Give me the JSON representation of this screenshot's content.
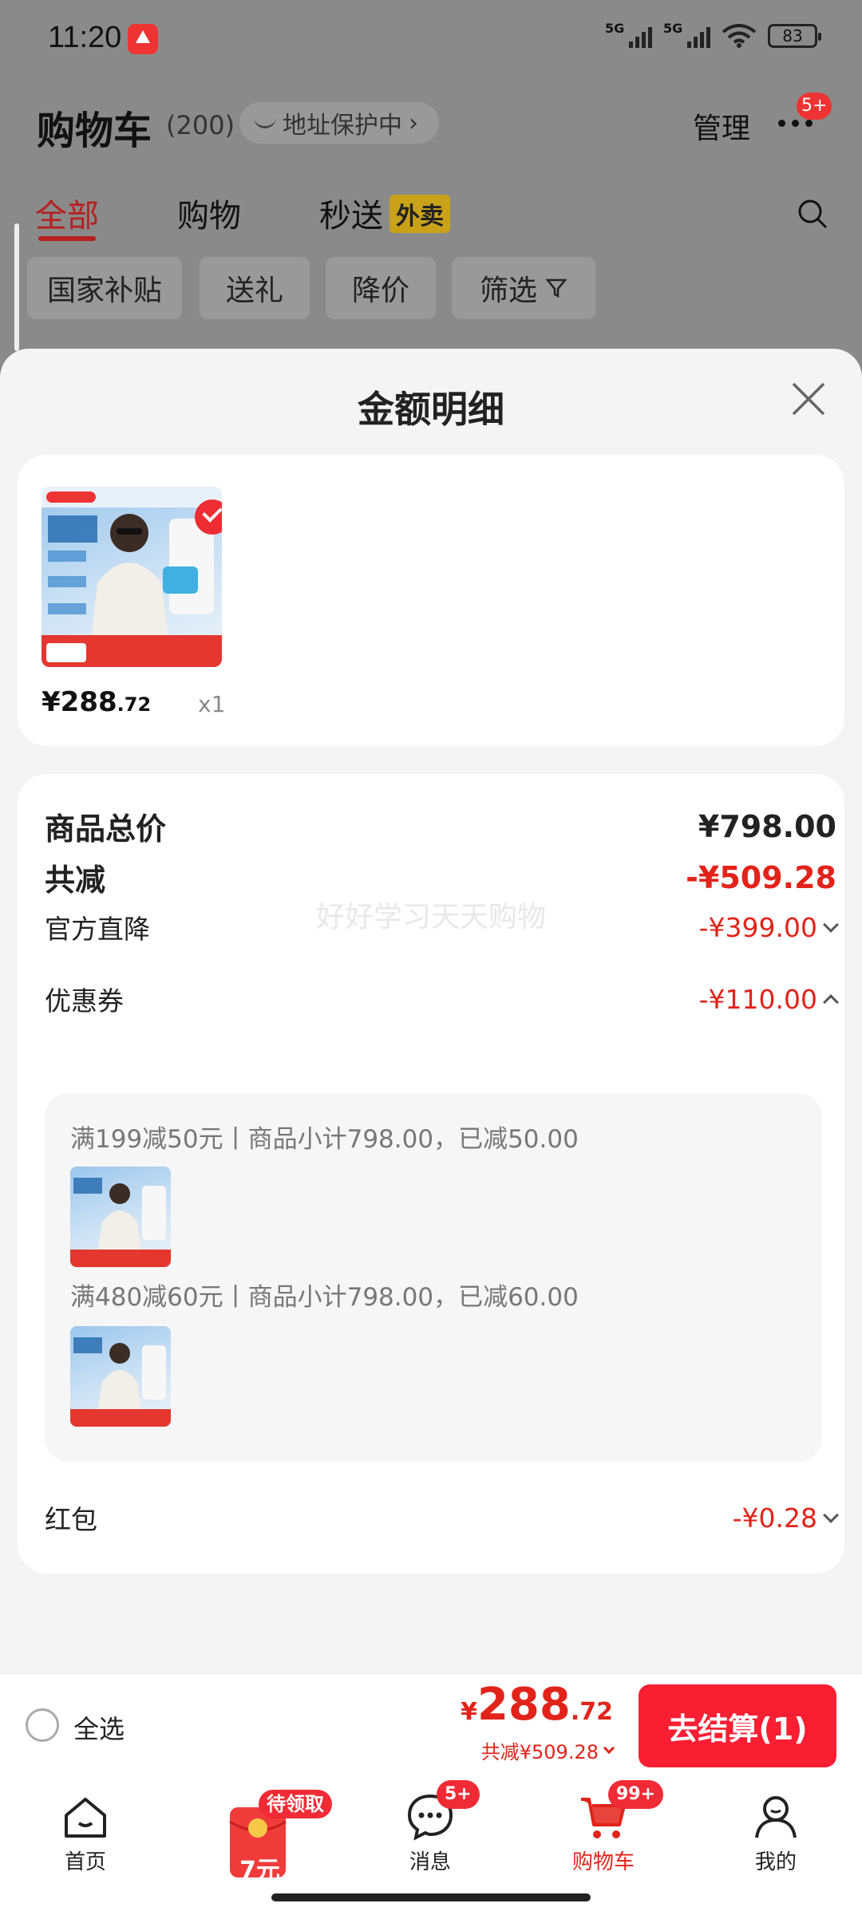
{
  "status": {
    "time": "11:20",
    "signal1": "5G",
    "signal2": "5G",
    "battery": "83"
  },
  "header": {
    "title": "购物车",
    "count": "(200)",
    "address": "地址保护中",
    "manage": "管理",
    "more_badge": "5+"
  },
  "tabs": [
    {
      "label": "全部",
      "active": true
    },
    {
      "label": "购物"
    },
    {
      "label": "秒送",
      "tag": "外卖"
    }
  ],
  "filters": [
    "国家补贴",
    "送礼",
    "降价",
    "筛选"
  ],
  "sheet": {
    "title": "金额明细",
    "product": {
      "price_int": "¥288",
      "price_dec": ".72",
      "qty": "x1"
    },
    "rows": {
      "total_label": "商品总价",
      "total_value": "¥798.00",
      "reduce_label": "共减",
      "reduce_value": "-¥509.28",
      "official_label": "官方直降",
      "official_value": "-¥399.00",
      "coupon_label": "优惠券",
      "coupon_value": "-¥110.00",
      "redpacket_label": "红包",
      "redpacket_value": "-¥0.28"
    },
    "watermark": "好好学习天天购物",
    "coupons": [
      {
        "text": "满199减50元丨商品小计798.00，已减50.00"
      },
      {
        "text": "满480减60元丨商品小计798.00，已减60.00"
      }
    ]
  },
  "checkout": {
    "select_all": "全选",
    "price_yen": "¥",
    "price_int": "288",
    "price_dec": ".72",
    "saved": "共减¥509.28",
    "pay_button": "去结算(1)"
  },
  "bottom_nav": {
    "home": "首页",
    "redpack_badge": "待领取",
    "redpack_amount": "7元",
    "messages": "消息",
    "messages_badge": "5+",
    "cart": "购物车",
    "cart_badge": "99+",
    "mine": "我的"
  },
  "colors": {
    "accent": "#e2231a",
    "pay_button": "#fa1e33",
    "tab_active": "#b81f1f"
  }
}
